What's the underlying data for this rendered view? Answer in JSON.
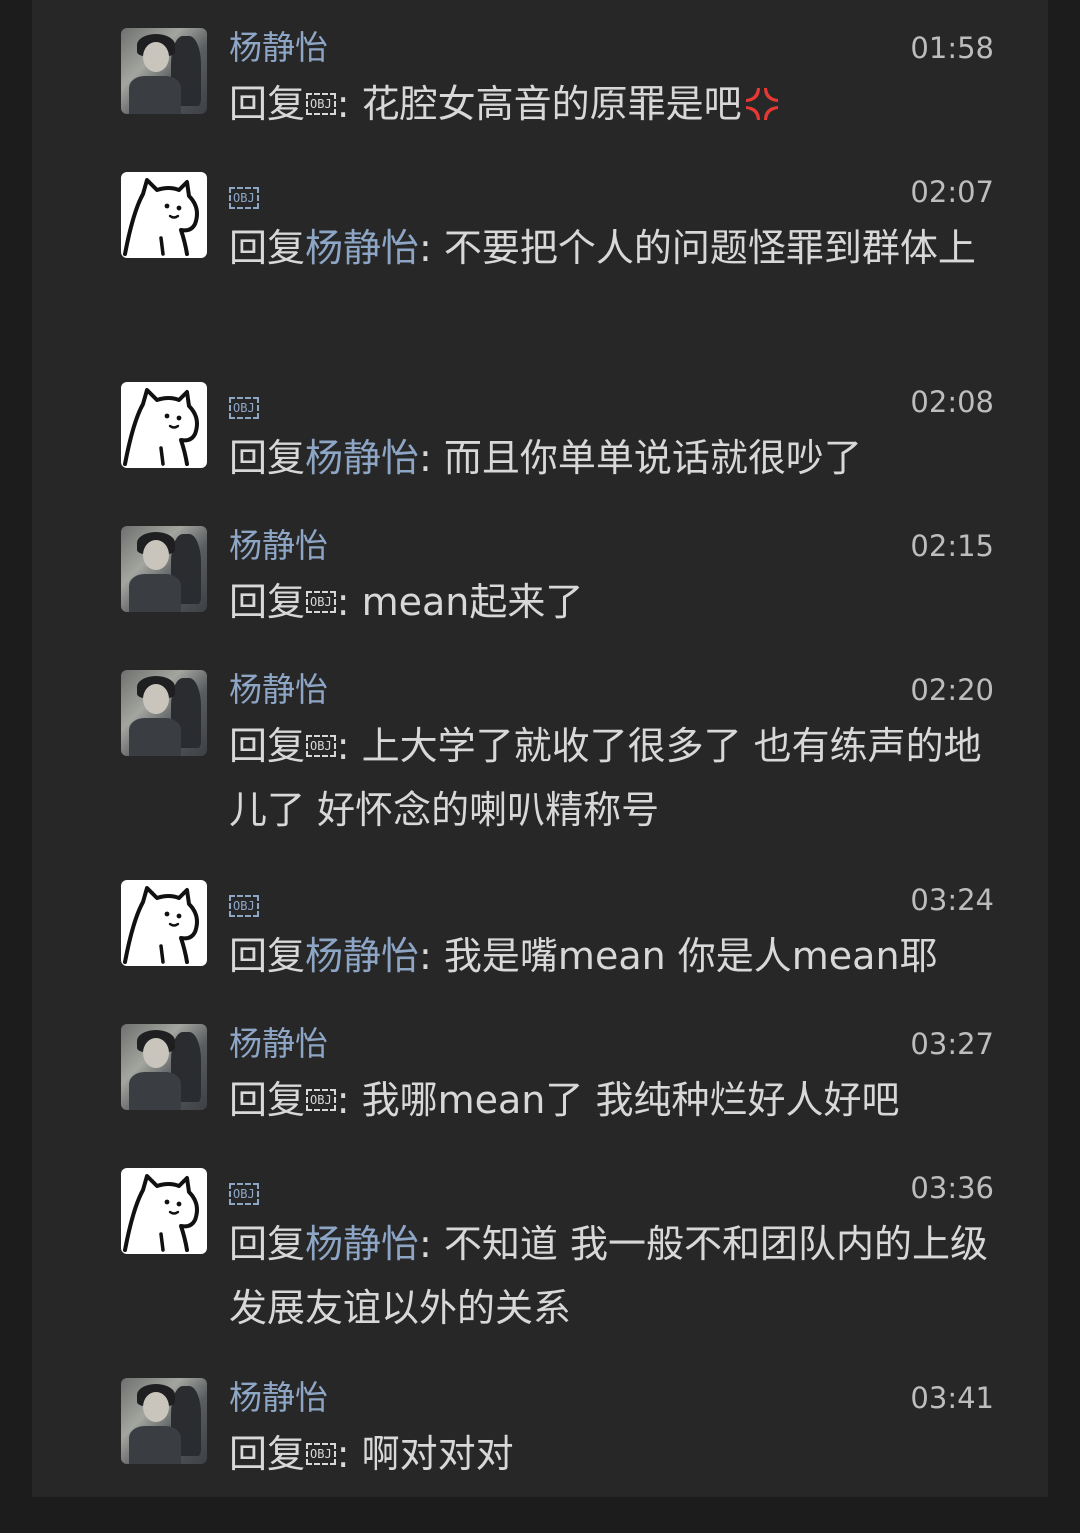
{
  "colors": {
    "background": "#1c1c1c",
    "panel": "#272727",
    "name": "#8ea6c6",
    "text": "#d8d8d8",
    "time": "#bdbdbd",
    "anger_emoji": "#e53935"
  },
  "messages": [
    {
      "avatar": "photo",
      "name": "杨静怡",
      "time": "01:58",
      "prefix": "回复",
      "target": "",
      "target_obj": "OBJ",
      "sep": ":",
      "body": " 花腔女高音的原罪是吧",
      "emoji": "anger-symbol"
    },
    {
      "avatar": "cat",
      "name": "",
      "name_obj": "OBJ",
      "time": "02:07",
      "prefix": "回复",
      "target": "杨静怡",
      "sep": ":",
      "body": " 不要把个人的问题怪罪到群体上"
    },
    {
      "avatar": "cat",
      "name": "",
      "name_obj": "OBJ",
      "time": "02:08",
      "prefix": "回复",
      "target": "杨静怡",
      "sep": ":",
      "body": " 而且你单单说话就很吵了"
    },
    {
      "avatar": "photo",
      "name": "杨静怡",
      "time": "02:15",
      "prefix": "回复",
      "target": "",
      "target_obj": "OBJ",
      "sep": ":",
      "body": " mean起来了"
    },
    {
      "avatar": "photo",
      "name": "杨静怡",
      "time": "02:20",
      "prefix": "回复",
      "target": "",
      "target_obj": "OBJ",
      "sep": ":",
      "body": " 上大学了就收了很多了 也有练声的地儿了 好怀念的喇叭精称号"
    },
    {
      "avatar": "cat",
      "name": "",
      "name_obj": "OBJ",
      "time": "03:24",
      "prefix": "回复",
      "target": "杨静怡",
      "sep": ":",
      "body": " 我是嘴mean 你是人mean耶"
    },
    {
      "avatar": "photo",
      "name": "杨静怡",
      "time": "03:27",
      "prefix": "回复",
      "target": "",
      "target_obj": "OBJ",
      "sep": ":",
      "body": " 我哪mean了 我纯种烂好人好吧"
    },
    {
      "avatar": "cat",
      "name": "",
      "name_obj": "OBJ",
      "time": "03:36",
      "prefix": "回复",
      "target": "杨静怡",
      "sep": ":",
      "body": " 不知道 我一般不和团队内的上级发展友谊以外的关系"
    },
    {
      "avatar": "photo",
      "name": "杨静怡",
      "time": "03:41",
      "prefix": "回复",
      "target": "",
      "target_obj": "OBJ",
      "sep": ":",
      "body": " 啊对对对"
    }
  ]
}
